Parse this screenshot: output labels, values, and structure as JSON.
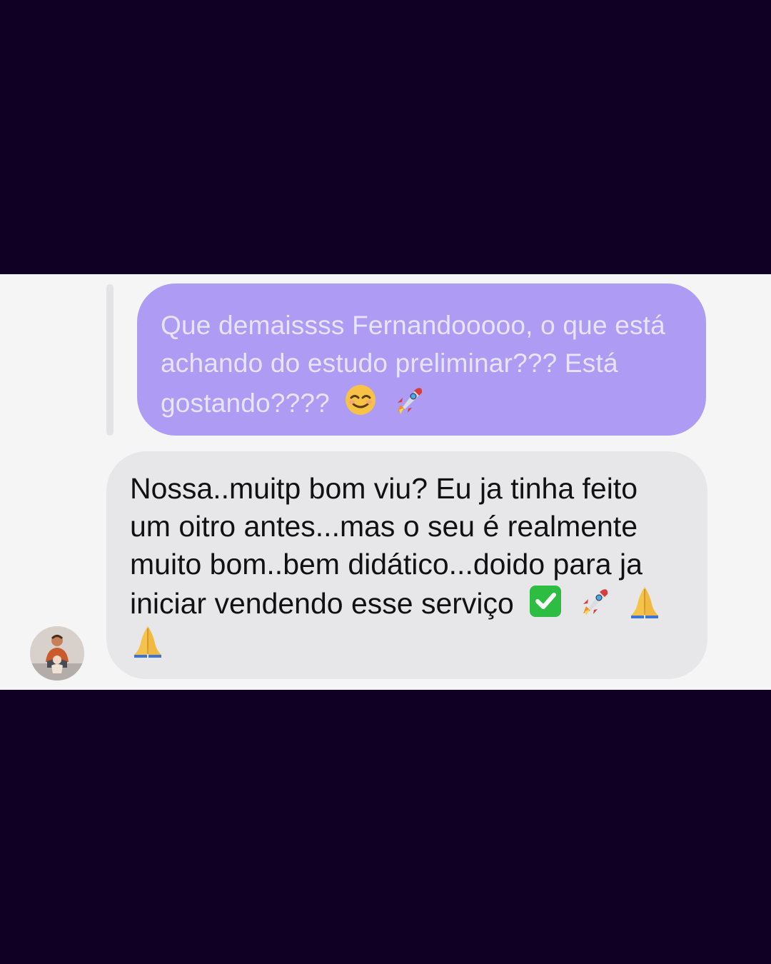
{
  "conversation": {
    "quoted_message": {
      "text": "Que demaissss Fernandooooo, o que está achando do estudo preliminar??? Está gostando????",
      "emojis": [
        "relaxed-face-emoji",
        "rocket-emoji"
      ]
    },
    "reply_message": {
      "text": "Nossa..muitp bom viu? Eu ja tinha feito um oitro antes...mas o seu é realmente muito bom..bem didático...doido para ja iniciar vendendo esse serviço",
      "emojis": [
        "check-mark-button-emoji",
        "rocket-emoji",
        "folded-hands-emoji",
        "folded-hands-emoji"
      ]
    },
    "avatar": {
      "icon": "avatar-photo"
    }
  },
  "colors": {
    "page_background": "#100024",
    "panel_background": "#f5f5f6",
    "quoted_bubble": "#ad9bf4",
    "reply_bubble": "#e7e7ea"
  }
}
